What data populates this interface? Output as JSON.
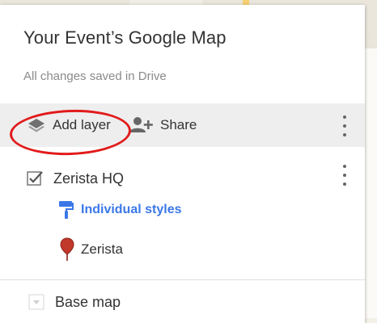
{
  "panel": {
    "title": "Your Event’s Google Map",
    "save_status": "All changes saved in Drive"
  },
  "toolbar": {
    "add_layer_label": "Add layer",
    "share_label": "Share"
  },
  "layer": {
    "name": "Zerista HQ",
    "checked": true,
    "styles_label": "Individual styles",
    "feature_label": "Zerista"
  },
  "basemap": {
    "label": "Base map"
  },
  "colors": {
    "accent_link": "#3b78e7",
    "annotation_circle": "#e21b1b",
    "marker": "#c0392b"
  },
  "icons": [
    "layers-icon",
    "add-person-icon",
    "more-vert-icon",
    "checkbox-checked-icon",
    "paint-roller-icon",
    "map-marker-icon",
    "dropdown-arrow-icon"
  ]
}
